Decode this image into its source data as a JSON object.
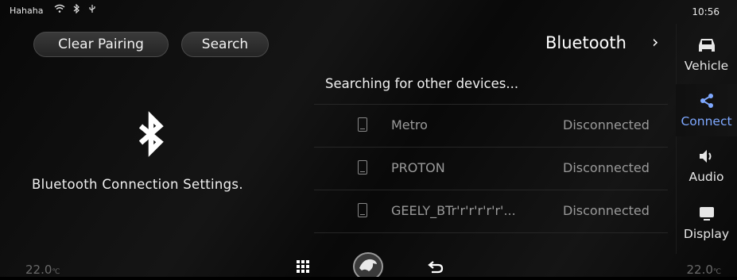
{
  "status_bar": {
    "user": "Hahaha",
    "icons": [
      "wifi-icon",
      "bluetooth-icon",
      "usb-icon"
    ],
    "time": "10:56"
  },
  "actions": {
    "clear_pairing": "Clear Pairing",
    "search": "Search"
  },
  "header": {
    "title": "Bluetooth",
    "chevron": "›"
  },
  "left_panel": {
    "settings_label": "Bluetooth Connection Settings."
  },
  "device_list": {
    "searching_text": "Searching for other devices...",
    "devices": [
      {
        "name": "Metro",
        "status": "Disconnected"
      },
      {
        "name": "PROTON",
        "status": "Disconnected"
      },
      {
        "name": "GEELY_BTr'r'r'r'r'r'...",
        "status": "Disconnected"
      }
    ]
  },
  "nav": {
    "items": [
      {
        "label": "Vehicle",
        "icon": "car-icon"
      },
      {
        "label": "Connect",
        "icon": "share-icon",
        "active": true
      },
      {
        "label": "Audio",
        "icon": "speaker-icon"
      },
      {
        "label": "Display",
        "icon": "display-icon"
      }
    ]
  },
  "bottom_bar": {
    "temp_left": "22.0",
    "temp_right": "22.0",
    "temp_unit": "℃"
  },
  "colors": {
    "active_accent": "#7ea8ff",
    "background": "#080808",
    "muted_text": "#9a9a9a"
  }
}
